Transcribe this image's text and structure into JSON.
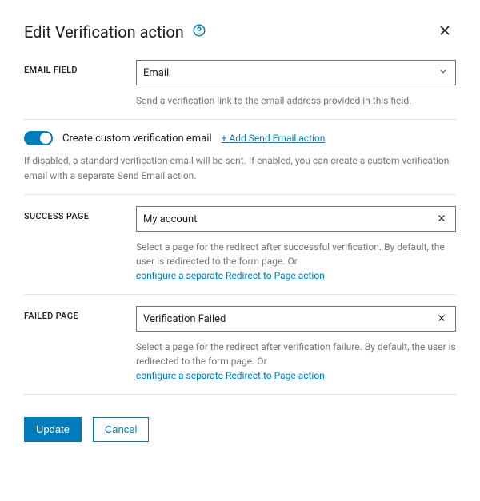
{
  "header": {
    "title": "Edit Verification action"
  },
  "email_field": {
    "label": "EMAIL FIELD",
    "value": "Email",
    "desc": "Send a verification link to the email address provided in this field."
  },
  "custom_email": {
    "toggle_label": "Create custom verification email",
    "add_link": "+ Add Send Email action",
    "desc": "If disabled, a standard verification email will be sent. If enabled, you can create a custom verification email with a separate Send Email action."
  },
  "success_page": {
    "label": "SUCCESS PAGE",
    "value": "My account",
    "desc_prefix": "Select a page for the redirect after successful verification. By default, the user is redirected to the form page. Or ",
    "link": "configure a separate Redirect to Page action"
  },
  "failed_page": {
    "label": "FAILED PAGE",
    "value": "Verification Failed",
    "desc_prefix": "Select a page for the redirect after verification failure. By default, the user is redirected to the form page. Or ",
    "link": "configure a separate Redirect to Page action"
  },
  "footer": {
    "update": "Update",
    "cancel": "Cancel"
  }
}
